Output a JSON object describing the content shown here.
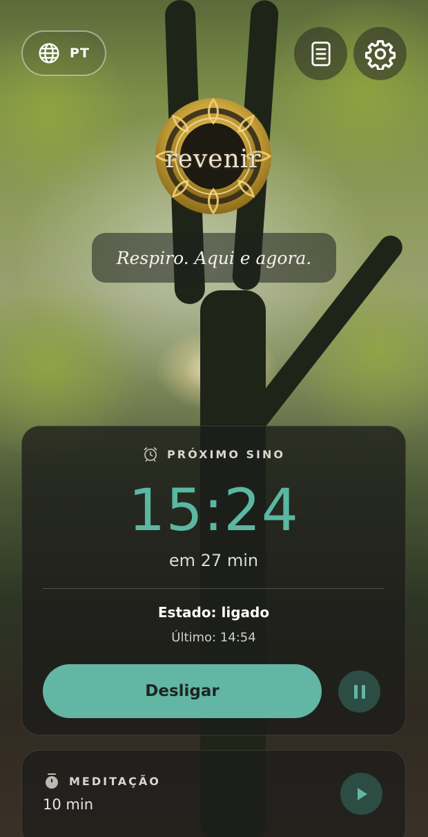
{
  "language": {
    "code": "PT",
    "icon": "globe-icon"
  },
  "header": {
    "doc_icon": "document-icon",
    "settings_icon": "gear-icon"
  },
  "logo": {
    "word": "revenir"
  },
  "tagline": "Respiro. Aqui e agora.",
  "next_bell": {
    "label": "PRÓXIMO SINO",
    "icon": "alarm-clock-icon",
    "time": "15:24",
    "in": "em 27 min",
    "state": "Estado: ligado",
    "last": "Último: 14:54",
    "off_label": "Desligar",
    "pause_icon": "pause-icon"
  },
  "meditation": {
    "label": "MEDITAÇÃO",
    "icon": "timer-icon",
    "duration": "10 min",
    "play_icon": "play-icon"
  },
  "colors": {
    "accent": "#63b6a4",
    "time": "#5ab7a2",
    "dark_button": "#2c4c44",
    "gold": "#c9a23a"
  }
}
